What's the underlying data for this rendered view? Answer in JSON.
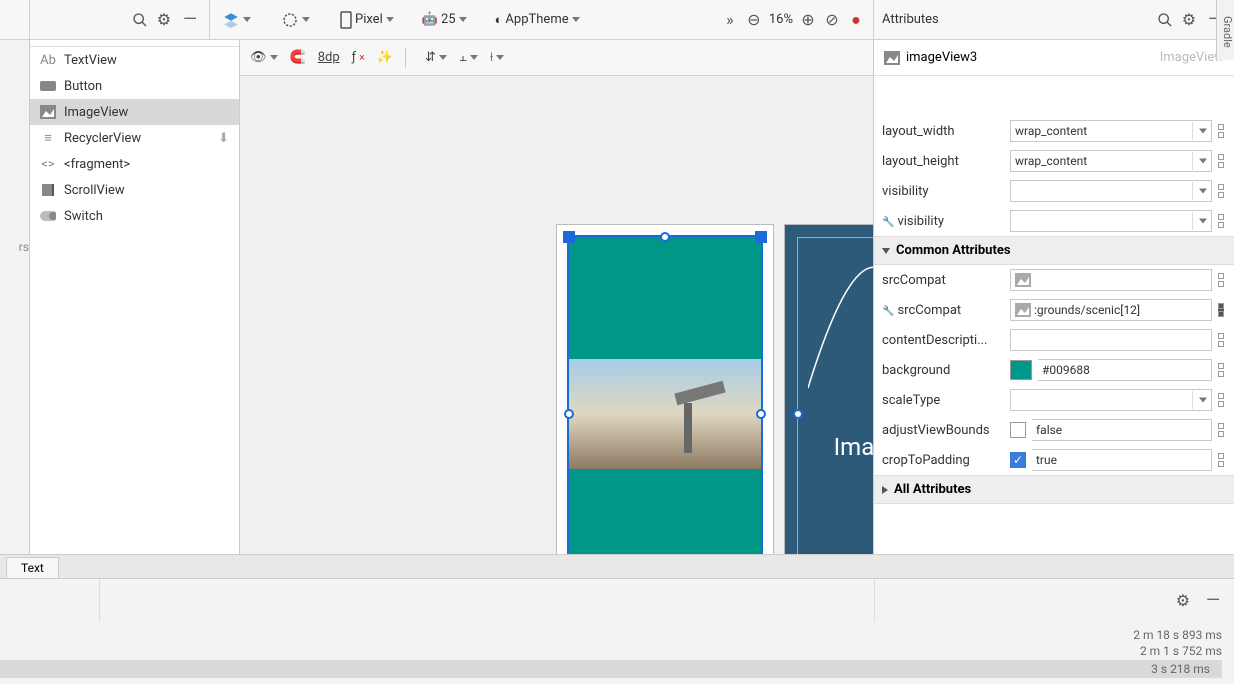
{
  "toolbar": {
    "device": "Pixel",
    "api": "25",
    "theme": "AppTheme",
    "zoom": "16%"
  },
  "palette": {
    "items": [
      {
        "label": "TextView"
      },
      {
        "label": "Button"
      },
      {
        "label": "ImageView"
      },
      {
        "label": "RecyclerView"
      },
      {
        "label": "<fragment>"
      },
      {
        "label": "ScrollView"
      },
      {
        "label": "Switch"
      }
    ]
  },
  "left_stub": "rs",
  "design_toolbar": {
    "margin": "8dp"
  },
  "blueprint": {
    "label": "ImageView"
  },
  "attrs": {
    "title": "Attributes",
    "id": "imageView3",
    "type": "ImageView",
    "layout_width_label": "layout_width",
    "layout_width": "wrap_content",
    "layout_height_label": "layout_height",
    "layout_height": "wrap_content",
    "visibility_label": "visibility",
    "visibility": "",
    "tools_visibility_label": "visibility",
    "tools_visibility": "",
    "section_common": "Common Attributes",
    "srcCompat_label": "srcCompat",
    "srcCompat": "",
    "tools_srcCompat_label": "srcCompat",
    "tools_srcCompat": ":grounds/scenic[12]",
    "contentDescription_label": "contentDescripti...",
    "contentDescription": "",
    "background_label": "background",
    "background": "#009688",
    "scaleType_label": "scaleType",
    "scaleType": "",
    "adjustViewBounds_label": "adjustViewBounds",
    "adjustViewBounds": "false",
    "cropToPadding_label": "cropToPadding",
    "cropToPadding": "true",
    "section_all": "All Attributes"
  },
  "gradle_tab": "Gradle",
  "bottom": {
    "tab": "Text",
    "status1": "2 m 18 s 893 ms",
    "status2": "2 m 1 s 752 ms",
    "status3": "3 s 218 ms"
  },
  "colors": {
    "teal": "#009688",
    "blueprint": "#2e5a7a"
  }
}
